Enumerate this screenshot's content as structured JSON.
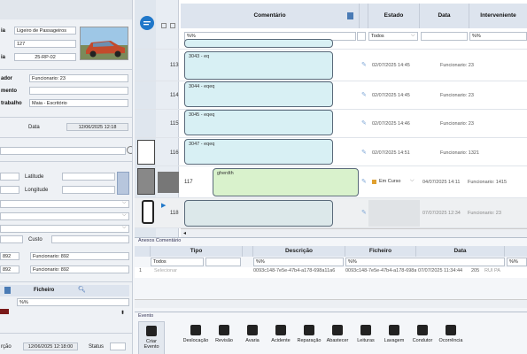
{
  "left": {
    "row1_label": "ia",
    "row1_value": "Ligeiro de Passageiros",
    "row2_value": "127",
    "row3_label": "ia",
    "row3_value": "25-RP-02",
    "dor_label": "ador",
    "dor_value": "Funcionario: 23",
    "mento_label": "mento",
    "trabalho_label": "trabalho",
    "trabalho_value": "Maia - Escritório",
    "data_label": "Data",
    "data_value": "12/06/2025 12:18",
    "latitude_label": "Latitude",
    "longitude_label": "Longitude",
    "custo_label": "Custo",
    "f892a": "892",
    "f892a_value": "Funcionario: 892",
    "f892b": "892",
    "f892b_value": "Funcionario: 892",
    "ficheiro_label": "Ficheiro",
    "filter": "%%",
    "bottom_label": "rção",
    "bottom_date": "12/06/2025 12:18:00",
    "status_label": "Status"
  },
  "grid": {
    "headers": {
      "comentario": "Comentário",
      "estado": "Estado",
      "data": "Data",
      "interveniente": "Interveniente"
    },
    "filters": {
      "comentario": "%%",
      "estado": "Todos",
      "interveniente": "%%"
    },
    "rows": [
      {
        "num": "",
        "comment": "",
        "estado": "",
        "data": "",
        "interveniente": ""
      },
      {
        "num": "113",
        "comment": "3043 - eq",
        "estado": "",
        "data": "02/07/2025 14:45",
        "interveniente": "Funcionario: 23"
      },
      {
        "num": "114",
        "comment": "3044 - eqeq",
        "estado": "",
        "data": "02/07/2025 14:45",
        "interveniente": "Funcionario: 23"
      },
      {
        "num": "115",
        "comment": "3045 - eqeq",
        "estado": "",
        "data": "02/07/2025 14:46",
        "interveniente": "Funcionario: 23"
      },
      {
        "num": "116",
        "comment": "3047 - eqeq",
        "estado": "",
        "data": "02/07/2025 14:51",
        "interveniente": "Funcionario: 1321"
      },
      {
        "num": "117",
        "comment": "gherdth",
        "estado": "Em Curso",
        "data": "04/07/2025 14:11",
        "interveniente": "Funcionario: 1415"
      },
      {
        "num": "118",
        "comment": "",
        "estado": "",
        "data": "07/07/2025 12:34",
        "interveniente": "Funcionario: 23"
      }
    ]
  },
  "attachments": {
    "tabs": "Anexos  Comentário",
    "headers": {
      "tipo": "Tipo",
      "descricao": "Descrição",
      "ficheiro": "Ficheiro",
      "data": "Data"
    },
    "filters": {
      "tipo": "Todos",
      "descricao": "%%",
      "ficheiro": "%%",
      "extra": "%%"
    },
    "row": {
      "num": "1",
      "tipo": "Selecionar",
      "descricao": "0093c148-7e5e-47b4-a178-698a11a6",
      "ficheiro": "0093c148-7e5e-47b4-a178-698a11a6",
      "data": "07/07/2025 11:34:44",
      "extra": "205",
      "extra2": "RUI PA"
    }
  },
  "event": {
    "label": "Evento",
    "buttons": [
      "Criar Evento",
      "Deslocação",
      "Revisão",
      "Avaria",
      "Acidente",
      "Reparação",
      "Abastecer",
      "Leituras",
      "Lavagem",
      "Condutor",
      "Ocorrência"
    ]
  }
}
